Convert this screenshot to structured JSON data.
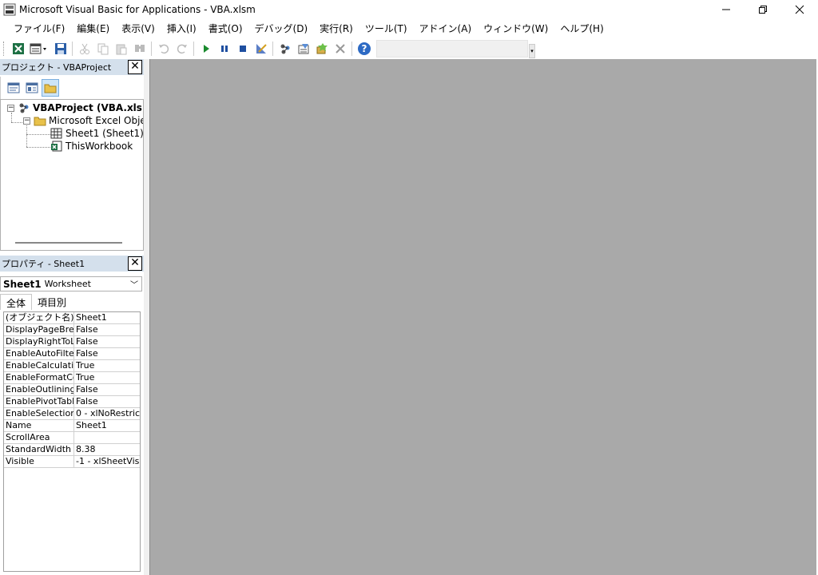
{
  "window": {
    "title": "Microsoft Visual Basic for Applications - VBA.xlsm",
    "minimize_icon": "minimize-icon",
    "restore_icon": "restore-icon",
    "close_icon": "close-icon"
  },
  "menu": {
    "items": [
      "ファイル(F)",
      "編集(E)",
      "表示(V)",
      "挿入(I)",
      "書式(O)",
      "デバッグ(D)",
      "実行(R)",
      "ツール(T)",
      "アドイン(A)",
      "ウィンドウ(W)",
      "ヘルプ(H)"
    ]
  },
  "toolbar": {
    "icons": [
      "excel-icon",
      "insert-userform-icon",
      "save-icon",
      "cut-icon",
      "copy-icon",
      "paste-icon",
      "find-icon",
      "undo-icon",
      "redo-icon",
      "run-icon",
      "break-icon",
      "reset-icon",
      "design-mode-icon",
      "project-explorer-icon",
      "properties-icon",
      "object-browser-icon",
      "toolbox-icon",
      "help-icon"
    ],
    "combo_value": ""
  },
  "project": {
    "title": "プロジェクト - VBAProject",
    "tree": [
      {
        "label": "VBAProject (VBA.xlsm",
        "bold": true
      },
      {
        "label": "Microsoft Excel Object"
      },
      {
        "label": "Sheet1 (Sheet1)"
      },
      {
        "label": "ThisWorkbook"
      }
    ]
  },
  "properties": {
    "title": "プロパティ - Sheet1",
    "object_name": "Sheet1",
    "object_type": "Worksheet",
    "tabs": [
      "全体",
      "項目別"
    ],
    "rows": [
      {
        "name": "(オブジェクト名)",
        "value": "Sheet1"
      },
      {
        "name": "DisplayPageBrea",
        "value": "False"
      },
      {
        "name": "DisplayRightToLe",
        "value": "False"
      },
      {
        "name": "EnableAutoFilter",
        "value": "False"
      },
      {
        "name": "EnableCalculatio",
        "value": "True"
      },
      {
        "name": "EnableFormatCor",
        "value": "True"
      },
      {
        "name": "EnableOutlining",
        "value": "False"
      },
      {
        "name": "EnablePivotTable",
        "value": "False"
      },
      {
        "name": "EnableSelection",
        "value": "0 - xlNoRestric"
      },
      {
        "name": "Name",
        "value": "Sheet1"
      },
      {
        "name": "ScrollArea",
        "value": ""
      },
      {
        "name": "StandardWidth",
        "value": "8.38"
      },
      {
        "name": "Visible",
        "value": "-1 - xlSheetVis"
      }
    ]
  },
  "colors": {
    "pane_title_bg": "#d4e0ec",
    "workspace_bg": "#a9a9a9"
  }
}
